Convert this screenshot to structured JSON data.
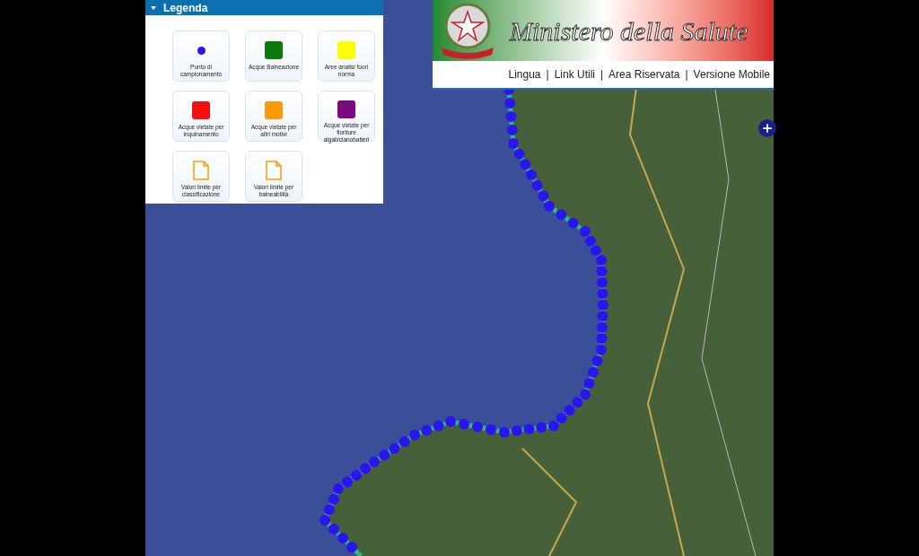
{
  "legend": {
    "title": "Legenda",
    "items": [
      {
        "kind": "dot",
        "color": "#2a14f0",
        "label": "Punto di campionamento"
      },
      {
        "kind": "swatch",
        "color": "#0b7a0b",
        "label": "Acque Balneazione"
      },
      {
        "kind": "swatch",
        "color": "#fbfb0a",
        "label": "Aree analisi fuori norma"
      },
      {
        "kind": "swatch",
        "color": "#f50f0f",
        "label": "Acque vietate per inquinamento"
      },
      {
        "kind": "swatch",
        "color": "#fb9a05",
        "label": "Acque vietate per altri motivi"
      },
      {
        "kind": "swatch",
        "color": "#7b0a7f",
        "label": "Acque vietate per fioriture algali/cianobatteri"
      },
      {
        "kind": "document",
        "label": "Valori limite per classificazione"
      },
      {
        "kind": "document",
        "label": "Valori limite per balneabilità"
      }
    ]
  },
  "header": {
    "title": "Ministero della Salute",
    "separator": "|",
    "links": [
      "Lingua",
      "Link Utili",
      "Area Riservata",
      "Versione Mobile"
    ]
  }
}
